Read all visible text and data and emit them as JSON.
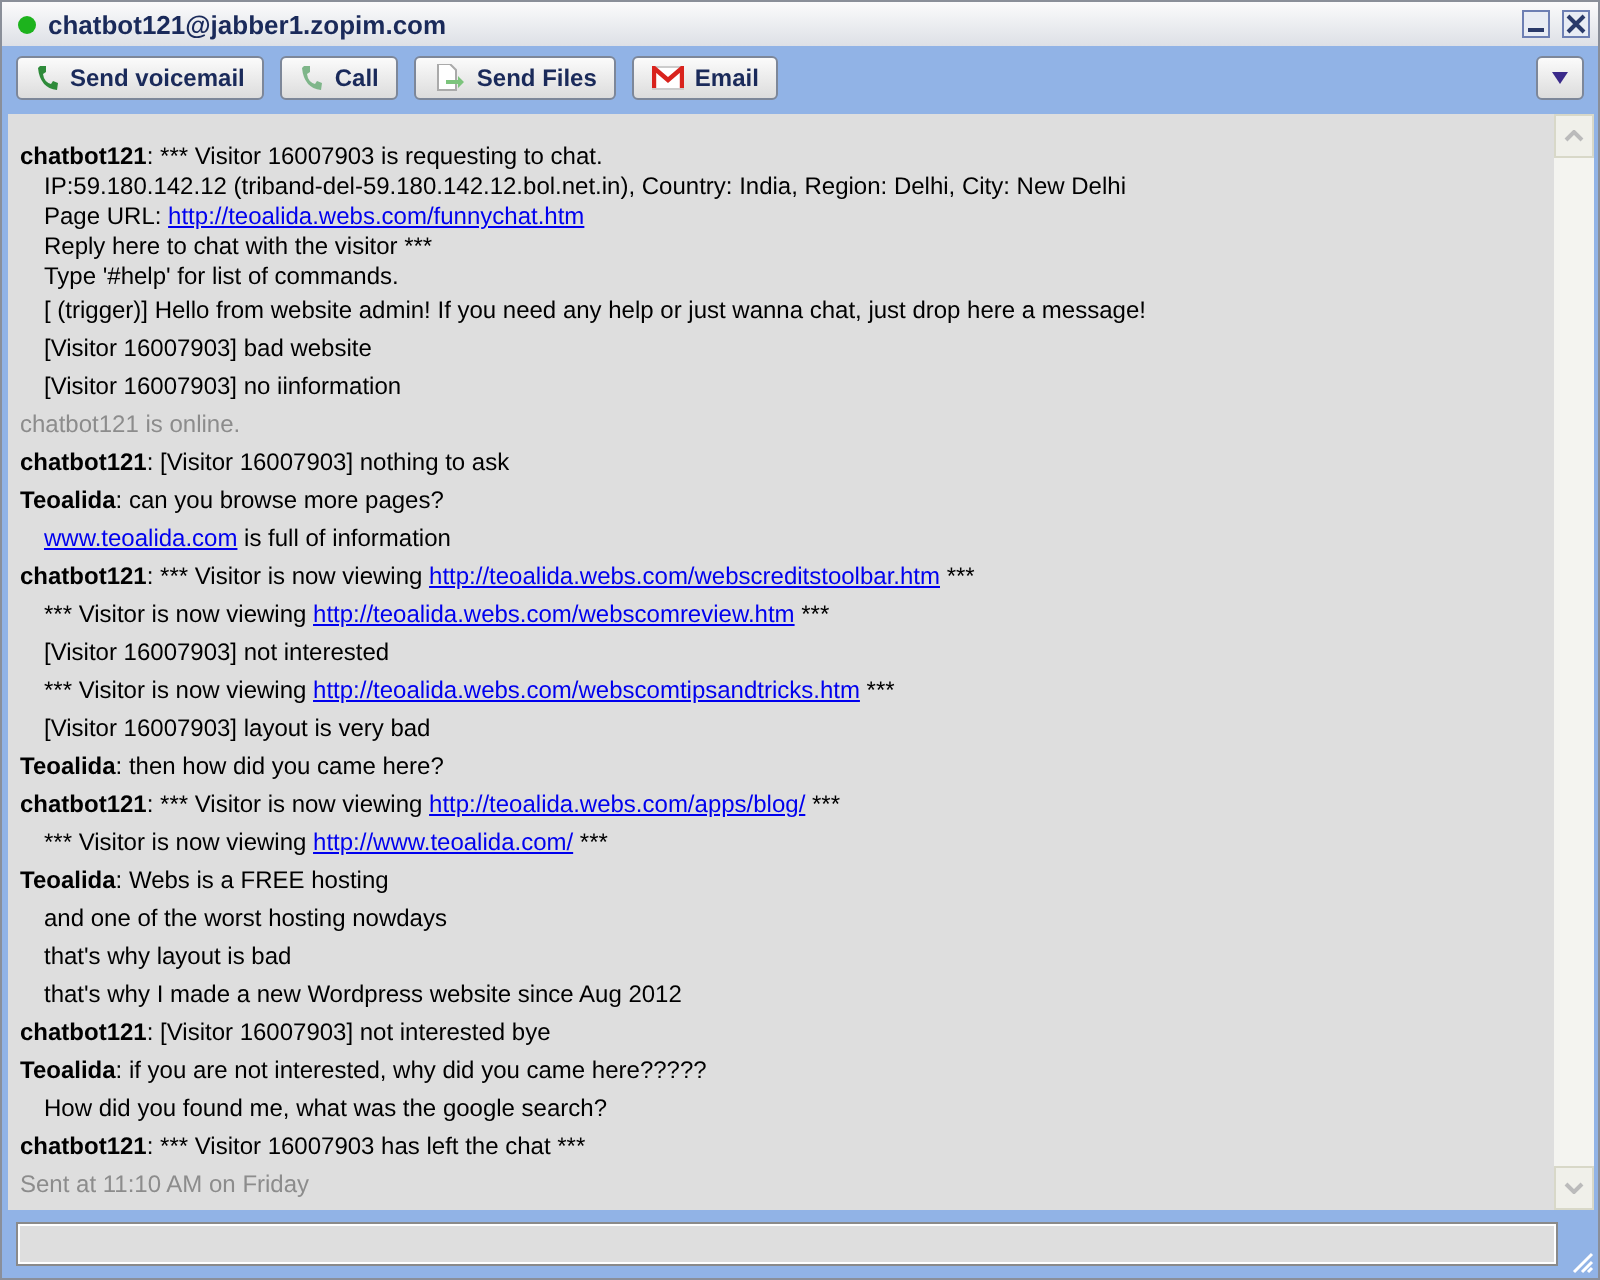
{
  "window": {
    "title": "chatbot121@jabber1.zopim.com"
  },
  "toolbar": [
    {
      "kind": "voicemail",
      "label": "Send voicemail"
    },
    {
      "kind": "call",
      "label": "Call"
    },
    {
      "kind": "files",
      "label": "Send Files"
    },
    {
      "kind": "email",
      "label": "Email"
    }
  ],
  "messages": [
    {
      "kind": "message",
      "sender": "chatbot121",
      "lines": [
        [
          {
            "text": ": *** Visitor 16007903 is requesting to chat."
          }
        ],
        [
          {
            "text": "IP:59.180.142.12 (triband-del-59.180.142.12.bol.net.in), Country: India, Region: Delhi, City: New Delhi"
          }
        ],
        [
          {
            "text": "Page URL: "
          },
          {
            "text": "http://teoalida.webs.com/funnychat.htm",
            "link": true
          }
        ],
        [
          {
            "text": "Reply here to chat with the visitor ***"
          }
        ],
        [
          {
            "text": "Type '#help' for list of commands."
          }
        ],
        [
          {
            "text": "[  (trigger)] Hello from website admin! If you need any help or just wanna chat, just drop here a message!"
          }
        ],
        [
          {
            "text": "[Visitor 16007903] bad website"
          }
        ],
        [
          {
            "text": "[Visitor 16007903] no iinformation"
          }
        ]
      ]
    },
    {
      "kind": "status",
      "text": "chatbot121 is online."
    },
    {
      "kind": "message",
      "sender": "chatbot121",
      "lines": [
        [
          {
            "text": ": [Visitor 16007903] nothing to ask"
          }
        ]
      ]
    },
    {
      "kind": "message",
      "sender": "Teoalida",
      "lines": [
        [
          {
            "text": ": can you browse more pages?"
          }
        ],
        [
          {
            "text": "www.teoalida.com",
            "link": true
          },
          {
            "text": " is full of information"
          }
        ]
      ]
    },
    {
      "kind": "message",
      "sender": "chatbot121",
      "lines": [
        [
          {
            "text": ": *** Visitor is now viewing "
          },
          {
            "text": "http://teoalida.webs.com/webscreditstoolbar.htm",
            "link": true
          },
          {
            "text": " ***"
          }
        ],
        [
          {
            "text": "*** Visitor is now viewing "
          },
          {
            "text": "http://teoalida.webs.com/webscomreview.htm",
            "link": true
          },
          {
            "text": " ***"
          }
        ],
        [
          {
            "text": "[Visitor 16007903] not interested"
          }
        ],
        [
          {
            "text": "*** Visitor is now viewing "
          },
          {
            "text": "http://teoalida.webs.com/webscomtipsandtricks.htm",
            "link": true
          },
          {
            "text": " ***"
          }
        ],
        [
          {
            "text": "[Visitor 16007903] layout is very bad"
          }
        ]
      ]
    },
    {
      "kind": "message",
      "sender": "Teoalida",
      "lines": [
        [
          {
            "text": ": then how did you came here?"
          }
        ]
      ]
    },
    {
      "kind": "message",
      "sender": "chatbot121",
      "lines": [
        [
          {
            "text": ": *** Visitor is now viewing "
          },
          {
            "text": "http://teoalida.webs.com/apps/blog/",
            "link": true
          },
          {
            "text": " ***"
          }
        ],
        [
          {
            "text": "*** Visitor is now viewing "
          },
          {
            "text": "http://www.teoalida.com/",
            "link": true
          },
          {
            "text": " ***"
          }
        ]
      ]
    },
    {
      "kind": "message",
      "sender": "Teoalida",
      "lines": [
        [
          {
            "text": ": Webs is a FREE hosting"
          }
        ],
        [
          {
            "text": "and one of the worst hosting nowdays"
          }
        ],
        [
          {
            "text": "that's why layout is bad"
          }
        ],
        [
          {
            "text": "that's why I made a new Wordpress website since Aug 2012"
          }
        ]
      ]
    },
    {
      "kind": "message",
      "sender": "chatbot121",
      "lines": [
        [
          {
            "text": ": [Visitor 16007903] not interested bye"
          }
        ]
      ]
    },
    {
      "kind": "message",
      "sender": "Teoalida",
      "lines": [
        [
          {
            "text": ": if you are not interested, why did you came here?????"
          }
        ],
        [
          {
            "text": "How did you found me, what was the google search?"
          }
        ]
      ]
    },
    {
      "kind": "message",
      "sender": "chatbot121",
      "lines": [
        [
          {
            "text": ": *** Visitor 16007903 has left the chat ***"
          }
        ]
      ]
    },
    {
      "kind": "status",
      "text": "Sent at 11:10 AM on Friday"
    }
  ]
}
